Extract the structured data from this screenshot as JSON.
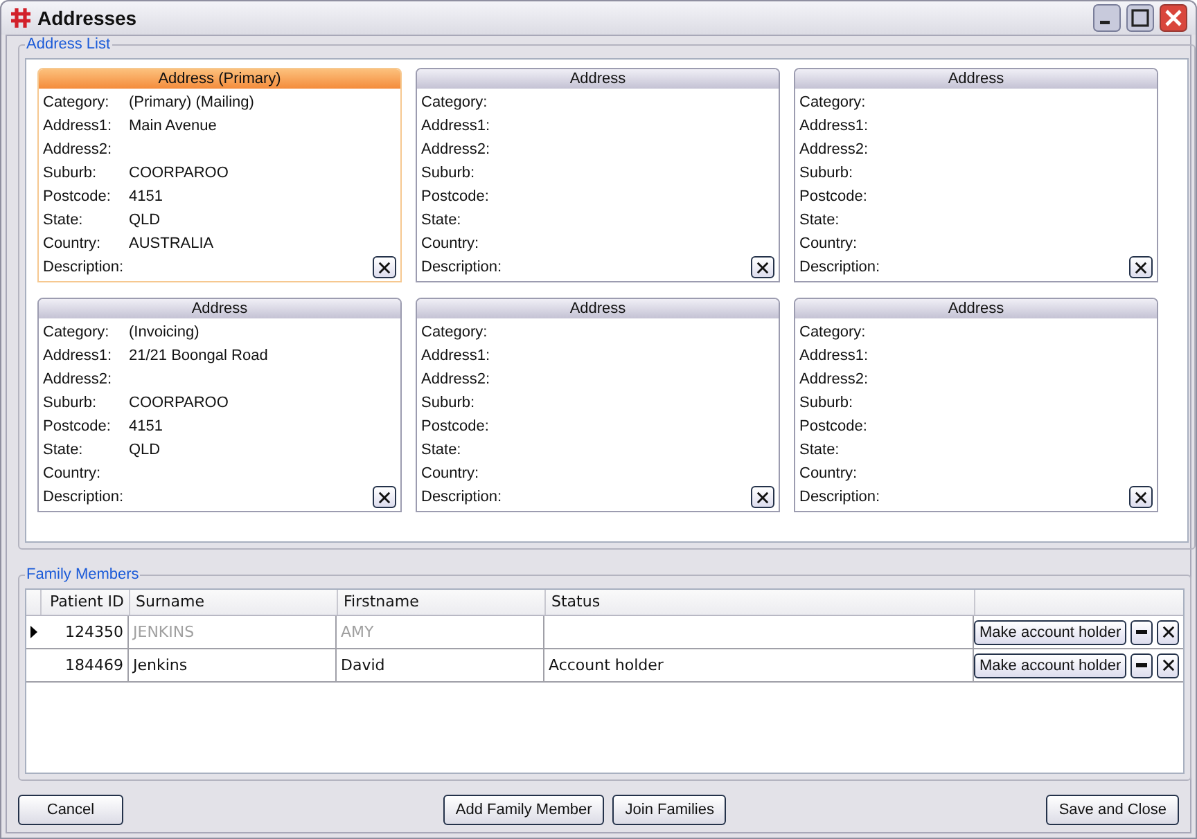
{
  "window": {
    "title": "Addresses"
  },
  "address_list": {
    "legend": "Address List",
    "cards": [
      {
        "title": "Address (Primary)",
        "primary": true,
        "fields": [
          {
            "label": "Category:",
            "value": "(Primary) (Mailing)"
          },
          {
            "label": "Address1:",
            "value": "Main Avenue"
          },
          {
            "label": "Address2:"
          },
          {
            "label": "Suburb:",
            "value": "COORPAROO"
          },
          {
            "label": "Postcode:",
            "value": "4151"
          },
          {
            "label": "State:",
            "value": "QLD"
          },
          {
            "label": "Country:",
            "value": "AUSTRALIA"
          },
          {
            "label": "Description:"
          }
        ]
      },
      {
        "title": "Address",
        "primary": false,
        "fields": [
          {
            "label": "Category:"
          },
          {
            "label": "Address1:"
          },
          {
            "label": "Address2:"
          },
          {
            "label": "Suburb:"
          },
          {
            "label": "Postcode:"
          },
          {
            "label": "State:"
          },
          {
            "label": "Country:"
          },
          {
            "label": "Description:"
          }
        ]
      },
      {
        "title": "Address",
        "primary": false,
        "fields": [
          {
            "label": "Category:"
          },
          {
            "label": "Address1:"
          },
          {
            "label": "Address2:"
          },
          {
            "label": "Suburb:"
          },
          {
            "label": "Postcode:"
          },
          {
            "label": "State:"
          },
          {
            "label": "Country:"
          },
          {
            "label": "Description:"
          }
        ]
      },
      {
        "title": "Address",
        "primary": false,
        "fields": [
          {
            "label": "Category:",
            "value": "(Invoicing)"
          },
          {
            "label": "Address1:",
            "value": "21/21 Boongal Road"
          },
          {
            "label": "Address2:"
          },
          {
            "label": "Suburb:",
            "value": "COORPAROO"
          },
          {
            "label": "Postcode:",
            "value": "4151"
          },
          {
            "label": "State:",
            "value": "QLD"
          },
          {
            "label": "Country:"
          },
          {
            "label": "Description:"
          }
        ]
      },
      {
        "title": "Address",
        "primary": false,
        "fields": [
          {
            "label": "Category:"
          },
          {
            "label": "Address1:"
          },
          {
            "label": "Address2:"
          },
          {
            "label": "Suburb:"
          },
          {
            "label": "Postcode:"
          },
          {
            "label": "State:"
          },
          {
            "label": "Country:"
          },
          {
            "label": "Description:"
          }
        ]
      },
      {
        "title": "Address",
        "primary": false,
        "fields": [
          {
            "label": "Category:"
          },
          {
            "label": "Address1:"
          },
          {
            "label": "Address2:"
          },
          {
            "label": "Suburb:"
          },
          {
            "label": "Postcode:"
          },
          {
            "label": "State:"
          },
          {
            "label": "Country:"
          },
          {
            "label": "Description:"
          }
        ]
      }
    ]
  },
  "family_members": {
    "legend": "Family Members",
    "columns": [
      "Patient ID",
      "Surname",
      "Firstname",
      "Status"
    ],
    "rows": [
      {
        "patient_id": "124350",
        "surname": "JENKINS",
        "firstname": "AMY",
        "selected": true,
        "inactive": true,
        "action": "Make account holder"
      },
      {
        "patient_id": "184469",
        "surname": "Jenkins",
        "firstname": "David",
        "status": "Account holder",
        "selected": false,
        "inactive": false,
        "action": "Make account holder"
      }
    ]
  },
  "buttons": {
    "cancel": "Cancel",
    "add": "Add Family Member",
    "join": "Join Families",
    "save": "Save and Close"
  }
}
